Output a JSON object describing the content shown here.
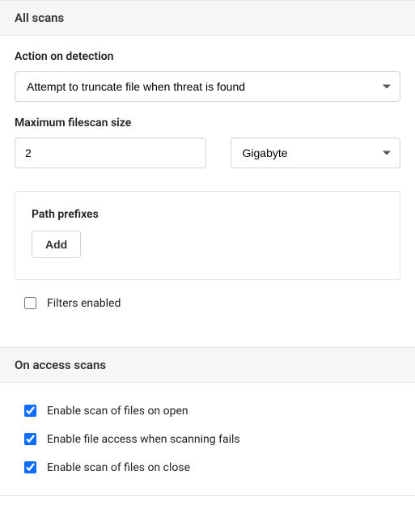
{
  "allScans": {
    "header": "All scans",
    "actionLabel": "Action on detection",
    "actionValue": "Attempt to truncate file when threat is found",
    "maxSizeLabel": "Maximum filescan size",
    "maxSizeValue": "2",
    "maxSizeUnit": "Gigabyte",
    "pathPrefixesLabel": "Path prefixes",
    "addButton": "Add",
    "filtersEnabledLabel": "Filters enabled",
    "filtersEnabledChecked": false
  },
  "onAccess": {
    "header": "On access scans",
    "options": [
      {
        "label": "Enable scan of files on open",
        "checked": true
      },
      {
        "label": "Enable file access when scanning fails",
        "checked": true
      },
      {
        "label": "Enable scan of files on close",
        "checked": true
      }
    ]
  }
}
